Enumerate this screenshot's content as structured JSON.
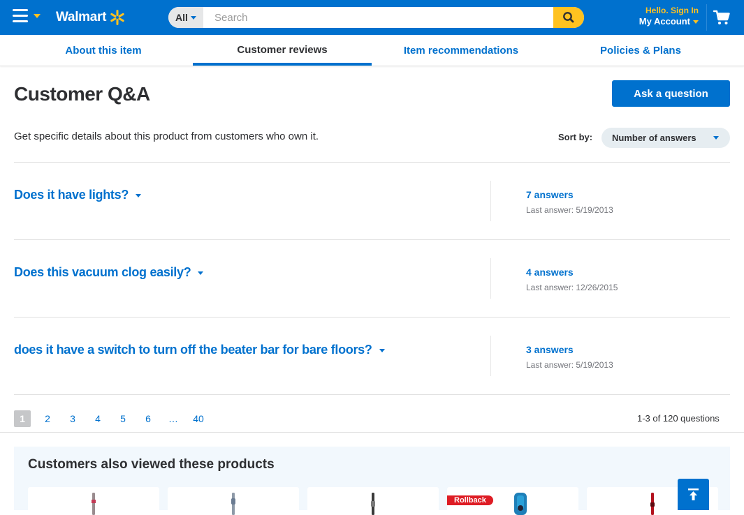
{
  "header": {
    "logo_text": "Walmart",
    "search": {
      "department": "All",
      "placeholder": "Search"
    },
    "account": {
      "greeting": "Hello. Sign In",
      "label": "My Account"
    }
  },
  "tabs": [
    {
      "label": "About this item",
      "active": false
    },
    {
      "label": "Customer reviews",
      "active": true
    },
    {
      "label": "Item recommendations",
      "active": false
    },
    {
      "label": "Policies & Plans",
      "active": false
    }
  ],
  "qa": {
    "title": "Customer Q&A",
    "ask_label": "Ask a question",
    "subtitle": "Get specific details about this product from customers who own it.",
    "sort_label": "Sort by:",
    "sort_value": "Number of answers",
    "questions": [
      {
        "text": "Does it have lights?",
        "answers": "7 answers",
        "last": "Last answer: 5/19/2013"
      },
      {
        "text": "Does this vacuum clog easily?",
        "answers": "4 answers",
        "last": "Last answer: 12/26/2015"
      },
      {
        "text": "does it have a switch to turn off the beater bar for bare floors?",
        "answers": "3 answers",
        "last": "Last answer: 5/19/2013"
      }
    ]
  },
  "pagination": {
    "pages": [
      "1",
      "2",
      "3",
      "4",
      "5",
      "6"
    ],
    "ellipsis": "…",
    "last_page": "40",
    "current": "1",
    "summary": "1-3 of 120 questions"
  },
  "also_viewed": {
    "title": "Customers also viewed these products",
    "rollback_label": "Rollback"
  },
  "colors": {
    "brand_blue": "#0071ce",
    "spark_yellow": "#ffc220",
    "rollback_red": "#de1c24"
  },
  "icons": {
    "menu": "hamburger-icon",
    "spark": "walmart-spark-icon",
    "search": "search-icon",
    "cart": "cart-icon",
    "back_to_top": "arrow-up-icon"
  }
}
